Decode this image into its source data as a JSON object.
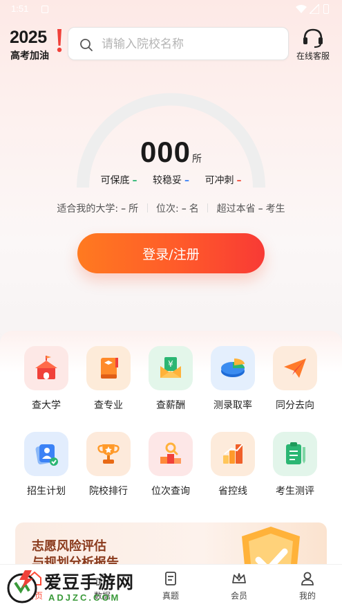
{
  "status_bar": {
    "time": "1:51"
  },
  "header": {
    "logo_year": "2025",
    "logo_slogan": "高考加油",
    "search_placeholder": "请输入院校名称",
    "service_label": "在线客服"
  },
  "score": {
    "value": "000",
    "unit": "所",
    "levels": [
      {
        "label": "可保底",
        "dash": "–",
        "color": "#2bb673"
      },
      {
        "label": "较稳妥",
        "dash": "–",
        "color": "#3b82f6"
      },
      {
        "label": "可冲刺",
        "dash": "–",
        "color": "#f04a3a"
      }
    ],
    "stats": {
      "suitable_label": "适合我的大学:",
      "suitable_value": "–",
      "suitable_unit": "所",
      "rank_label": "位次:",
      "rank_value": "–",
      "rank_unit": "名",
      "exceed_label": "超过本省",
      "exceed_value": "–",
      "exceed_unit": "考生"
    },
    "login_label": "登录/注册"
  },
  "features": [
    {
      "label": "查大学",
      "icon": "university-icon",
      "bg": "#fde8e6"
    },
    {
      "label": "查专业",
      "icon": "book-icon",
      "bg": "#fdebd9"
    },
    {
      "label": "查薪酬",
      "icon": "salary-envelope-icon",
      "bg": "#e3f6ea"
    },
    {
      "label": "测录取率",
      "icon": "pie-chart-icon",
      "bg": "#e4effd"
    },
    {
      "label": "同分去向",
      "icon": "paper-plane-icon",
      "bg": "#fdebdc"
    },
    {
      "label": "招生计划",
      "icon": "enrollment-plan-icon",
      "bg": "#e2edfd"
    },
    {
      "label": "院校排行",
      "icon": "trophy-icon",
      "bg": "#fdeadb"
    },
    {
      "label": "位次查询",
      "icon": "rank-search-icon",
      "bg": "#fde7e7"
    },
    {
      "label": "省控线",
      "icon": "bar-chart-icon",
      "bg": "#fdebdb"
    },
    {
      "label": "考生测评",
      "icon": "clipboard-icon",
      "bg": "#e2f5ea"
    }
  ],
  "banner": {
    "line1": "志愿风险评估",
    "line2": "与规划分析报告"
  },
  "tabs": [
    {
      "label": "首页",
      "icon": "home-icon",
      "active": true
    },
    {
      "label": "数据",
      "icon": "data-icon",
      "active": false
    },
    {
      "label": "真题",
      "icon": "exam-icon",
      "active": false
    },
    {
      "label": "会员",
      "icon": "crown-icon",
      "active": false
    },
    {
      "label": "我的",
      "icon": "user-icon",
      "active": false
    }
  ],
  "watermark": {
    "text": "爱豆手游网",
    "url": "ADJZC.COM"
  }
}
